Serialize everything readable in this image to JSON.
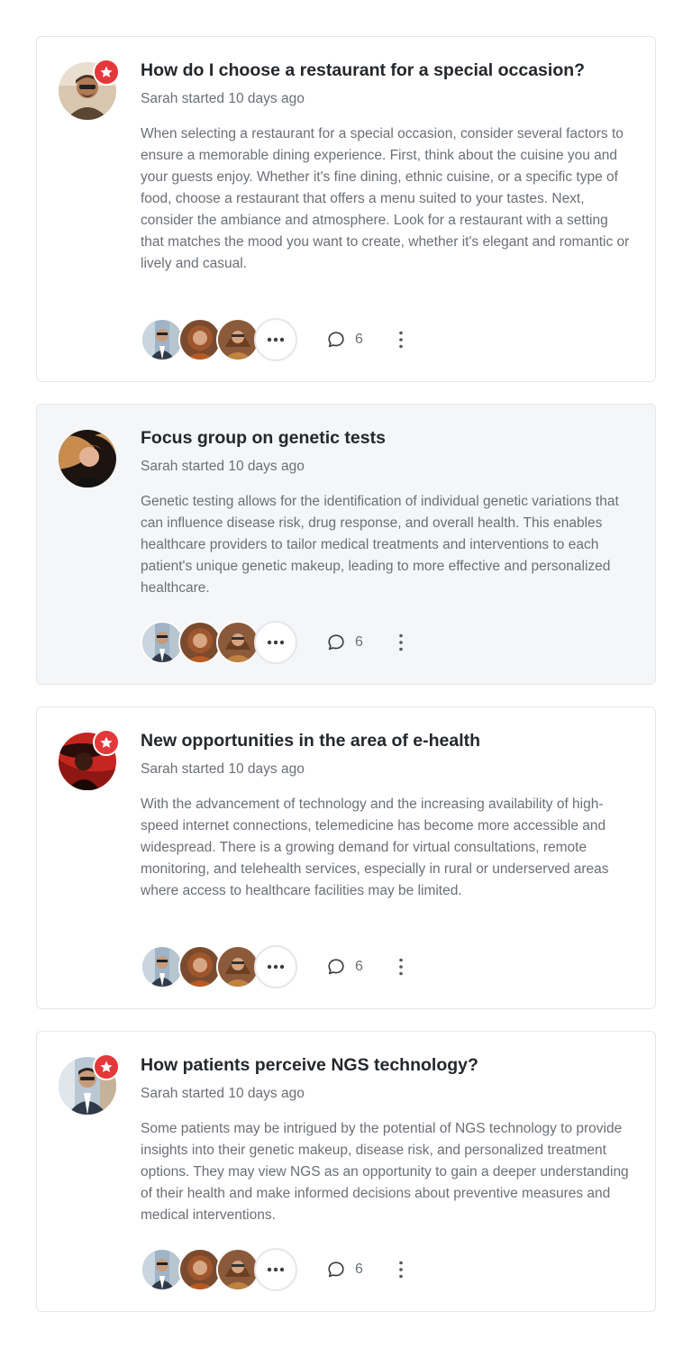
{
  "threads": [
    {
      "title": "How do I choose a restaurant for a special occasion?",
      "meta": "Sarah started 10 days ago",
      "body": "When selecting a restaurant for a special occasion, consider several factors to ensure a memorable dining experience. First, think about the cuisine you and your guests enjoy. Whether it's fine dining, ethnic cuisine, or a specific type of food, choose a restaurant that offers a menu suited to your tastes. Next, consider the ambiance and atmosphere. Look for a restaurant with a setting that matches the mood you want to create, whether it's elegant and romantic or lively and casual.",
      "comment_count": "6",
      "starred": true,
      "selected": false,
      "avatar": "man-with-sunglasses"
    },
    {
      "title": "Focus group on genetic tests",
      "meta": "Sarah started 10 days ago",
      "body": "Genetic testing allows for the identification of individual genetic variations that can influence disease risk, drug response, and overall health. This enables healthcare providers to tailor medical treatments and interventions to each patient's unique genetic makeup, leading to more effective and personalized healthcare.",
      "comment_count": "6",
      "starred": false,
      "selected": true,
      "avatar": "woman-windblown-hair"
    },
    {
      "title": "New opportunities in the area of e-health",
      "meta": "Sarah started 10 days ago",
      "body": "With the advancement of technology and the increasing availability of high-speed internet connections, telemedicine has become more accessible and widespread. There is a growing demand for virtual consultations, remote monitoring, and telehealth services, especially in rural or underserved areas where access to healthcare facilities may be limited.",
      "comment_count": "6",
      "starred": true,
      "selected": false,
      "avatar": "woman-red-hat"
    },
    {
      "title": "How patients perceive NGS technology?",
      "meta": "Sarah started 10 days ago",
      "body": "Some patients may be intrigued by the potential of NGS technology to provide insights into their genetic makeup, disease risk, and personalized treatment options. They may view NGS as an opportunity to gain a deeper understanding of their health and make informed decisions about preventive measures and medical interventions.",
      "comment_count": "6",
      "starred": true,
      "selected": false,
      "avatar": "man-in-suit"
    }
  ],
  "participants": [
    "man-in-suit",
    "woman-curly-hair",
    "woman-sunglasses"
  ],
  "icons": {
    "star": "star-icon",
    "more": "more-horizontal-icon",
    "comment": "comment-icon",
    "kebab": "more-vertical-icon"
  },
  "colors": {
    "star_badge": "#e5383b",
    "selected_card": "#f5f6f8",
    "border": "#e6e7ea",
    "title": "#24272b",
    "muted_text": "#6b6f76"
  }
}
